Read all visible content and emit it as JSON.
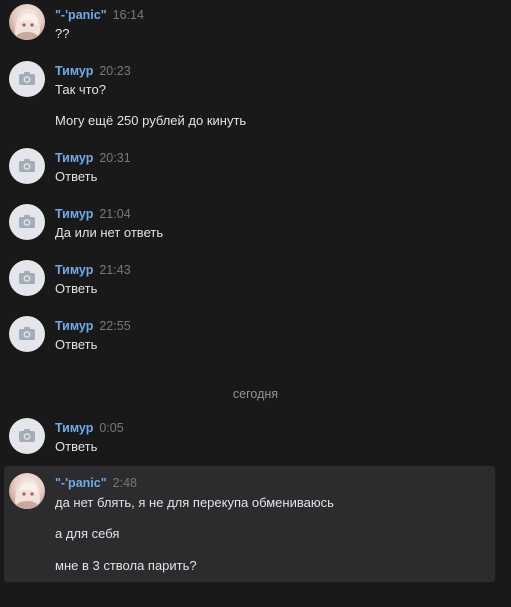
{
  "messages": [
    {
      "author": "\"-'panic\"",
      "time": "16:14",
      "avatar_icon": "anime-avatar-icon",
      "lines": [
        "??"
      ]
    },
    {
      "author": "Тимур",
      "time": "20:23",
      "avatar_icon": "camera-icon",
      "lines": [
        "Так что?",
        "Могу ещё 250 рублей до кинуть"
      ]
    },
    {
      "author": "Тимур",
      "time": "20:31",
      "avatar_icon": "camera-icon",
      "lines": [
        "Ответь"
      ]
    },
    {
      "author": "Тимур",
      "time": "21:04",
      "avatar_icon": "camera-icon",
      "lines": [
        "Да или нет ответь"
      ]
    },
    {
      "author": "Тимур",
      "time": "21:43",
      "avatar_icon": "camera-icon",
      "lines": [
        "Ответь"
      ]
    },
    {
      "author": "Тимур",
      "time": "22:55",
      "avatar_icon": "camera-icon",
      "lines": [
        "Ответь"
      ]
    },
    {
      "author": "Тимур",
      "time": "0:05",
      "avatar_icon": "camera-icon",
      "lines": [
        "Ответь"
      ]
    },
    {
      "author": "\"-'panic\"",
      "time": "2:48",
      "avatar_icon": "anime-avatar-icon",
      "lines": [
        "да нет блять, я не для перекупа обмениваюсь",
        "а для себя",
        "мне в 3 ствола парить?"
      ]
    }
  ],
  "date_separator": "сегодня",
  "colors": {
    "background": "#19191a",
    "author": "#71aaeb",
    "time": "#76787a",
    "text": "#e1e3e6",
    "highlight": "#2c2c2e"
  }
}
